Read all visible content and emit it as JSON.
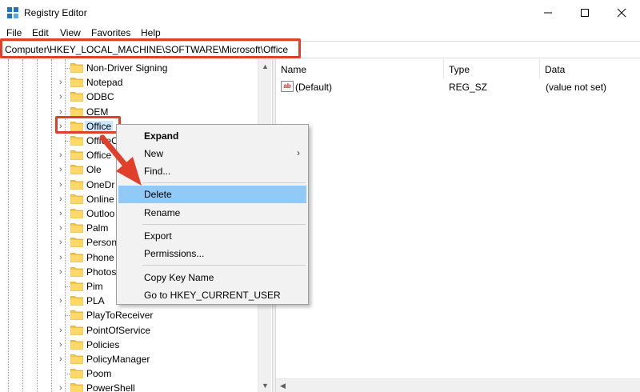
{
  "window": {
    "title": "Registry Editor",
    "icon": "registry-icon",
    "controls": [
      "minimize-icon",
      "maximize-icon",
      "close-icon"
    ]
  },
  "menubar": [
    "File",
    "Edit",
    "View",
    "Favorites",
    "Help"
  ],
  "address": {
    "path": "Computer\\HKEY_LOCAL_MACHINE\\SOFTWARE\\Microsoft\\Office"
  },
  "tree": {
    "items": [
      {
        "label": "Non-Driver Signing",
        "expandable": false
      },
      {
        "label": "Notepad",
        "expandable": true
      },
      {
        "label": "ODBC",
        "expandable": true
      },
      {
        "label": "OEM",
        "expandable": true
      },
      {
        "label": "Office",
        "expandable": true,
        "selected": true
      },
      {
        "label": "OfficeC",
        "expandable": false
      },
      {
        "label": "Office",
        "expandable": true
      },
      {
        "label": "Ole",
        "expandable": true
      },
      {
        "label": "OneDr",
        "expandable": true
      },
      {
        "label": "Online",
        "expandable": true
      },
      {
        "label": "Outloo",
        "expandable": true
      },
      {
        "label": "Palm",
        "expandable": true
      },
      {
        "label": "Person",
        "expandable": true
      },
      {
        "label": "Phone",
        "expandable": true
      },
      {
        "label": "Photos",
        "expandable": true
      },
      {
        "label": "Pim",
        "expandable": false
      },
      {
        "label": "PLA",
        "expandable": true
      },
      {
        "label": "PlayToReceiver",
        "expandable": false
      },
      {
        "label": "PointOfService",
        "expandable": true
      },
      {
        "label": "Policies",
        "expandable": true
      },
      {
        "label": "PolicyManager",
        "expandable": true
      },
      {
        "label": "Poom",
        "expandable": false
      },
      {
        "label": "PowerShell",
        "expandable": true
      }
    ]
  },
  "list": {
    "columns": [
      "Name",
      "Type",
      "Data"
    ],
    "rows": [
      {
        "name": "(Default)",
        "type": "REG_SZ",
        "data": "(value not set)",
        "icon": "string-value-icon"
      }
    ]
  },
  "context_menu": {
    "items": [
      {
        "label": "Expand",
        "bold": true
      },
      {
        "label": "New",
        "submenu": true
      },
      {
        "label": "Find..."
      },
      {
        "separator": true
      },
      {
        "label": "Delete",
        "hover": true
      },
      {
        "label": "Rename"
      },
      {
        "separator": true
      },
      {
        "label": "Export"
      },
      {
        "label": "Permissions..."
      },
      {
        "separator": true
      },
      {
        "label": "Copy Key Name"
      },
      {
        "label": "Go to HKEY_CURRENT_USER"
      }
    ]
  },
  "colors": {
    "annotation": "#e0402a",
    "selection": "#cce8ff",
    "menu_hover": "#91c9f7",
    "folder": "#f5c542"
  }
}
